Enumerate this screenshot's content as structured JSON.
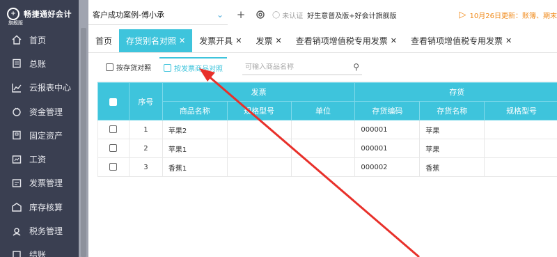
{
  "app": {
    "logo_text": "畅捷通好会计",
    "logo_sub": "旗舰版"
  },
  "sidebar": {
    "items": [
      {
        "label": "首页",
        "icon": "home-icon"
      },
      {
        "label": "总账",
        "icon": "ledger-icon"
      },
      {
        "label": "云报表中心",
        "icon": "chart-icon"
      },
      {
        "label": "资金管理",
        "icon": "money-bag-icon"
      },
      {
        "label": "固定资产",
        "icon": "building-icon"
      },
      {
        "label": "工资",
        "icon": "payroll-icon"
      },
      {
        "label": "发票管理",
        "icon": "invoice-icon"
      },
      {
        "label": "库存核算",
        "icon": "warehouse-icon"
      },
      {
        "label": "税务管理",
        "icon": "tax-icon"
      },
      {
        "label": "结账",
        "icon": "close-account-icon"
      }
    ]
  },
  "topbar": {
    "company": "客户成功案例-傅小承",
    "cert_status": "未认证",
    "edition": "好生意普及版+好会计旗舰版",
    "notice": "10月26日更新：账簿、期末"
  },
  "tabs": [
    {
      "label": "首页",
      "closable": false,
      "active": false
    },
    {
      "label": "存货别名对照",
      "closable": true,
      "active": true
    },
    {
      "label": "发票开具",
      "closable": true,
      "active": false
    },
    {
      "label": "发票",
      "closable": true,
      "active": false
    },
    {
      "label": "查看销项增值税专用发票",
      "closable": true,
      "active": false
    },
    {
      "label": "查看销项增值税专用发票",
      "closable": true,
      "active": false
    }
  ],
  "subtabs": [
    {
      "label": "按存货对照",
      "active": false
    },
    {
      "label": "按发票商品对照",
      "active": true
    }
  ],
  "search": {
    "placeholder": "可输入商品名称"
  },
  "table": {
    "group_headers": {
      "seq": "序号",
      "invoice": "发票",
      "inventory": "存货"
    },
    "columns": {
      "product_name": "商品名称",
      "spec": "规格型号",
      "unit": "单位",
      "inv_code": "存货编码",
      "inv_name": "存货名称",
      "inv_spec": "规格型号"
    },
    "rows": [
      {
        "seq": "1",
        "product_name": "苹果2",
        "spec": "",
        "unit": "",
        "inv_code": "000001",
        "inv_name": "苹果",
        "inv_spec": ""
      },
      {
        "seq": "2",
        "product_name": "苹果1",
        "spec": "",
        "unit": "",
        "inv_code": "000001",
        "inv_name": "苹果",
        "inv_spec": ""
      },
      {
        "seq": "3",
        "product_name": "香蕉1",
        "spec": "",
        "unit": "",
        "inv_code": "000002",
        "inv_name": "香蕉",
        "inv_spec": ""
      }
    ]
  },
  "colors": {
    "accent": "#3ec4dc",
    "sidebar_bg": "#3a3f51",
    "notice": "#f08a1a",
    "annotation_arrow": "#e8302a"
  }
}
